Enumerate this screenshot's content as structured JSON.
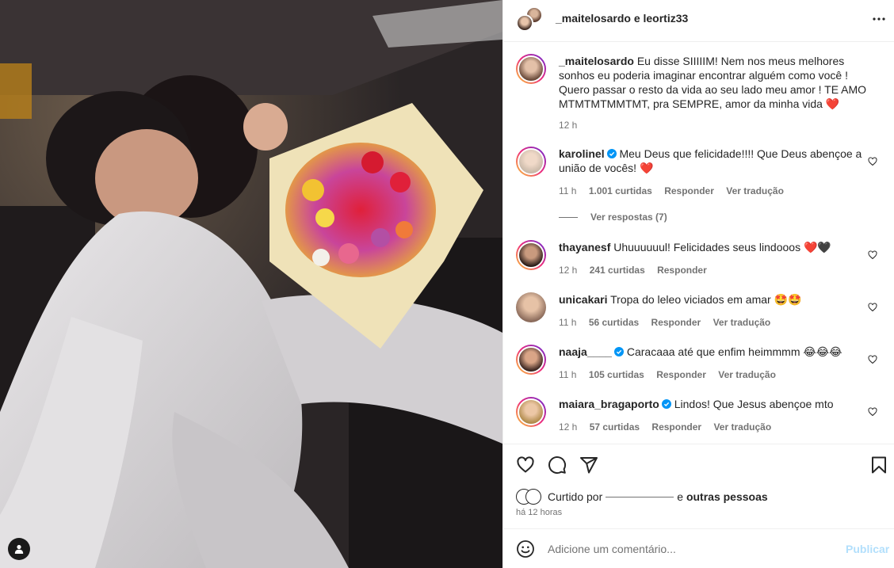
{
  "header": {
    "title": "_maitelosardo e leortiz33"
  },
  "caption": {
    "user": "_maitelosardo",
    "text": "Eu disse SIIIIIM! Nem nos meus melhores sonhos eu poderia imaginar encontrar alguém como você ! Quero passar o resto da vida ao seu lado meu amor ! TE AMO MTMTMTMMTMT, pra SEMPRE, amor da minha vida",
    "emoji": "❤️",
    "time": "12 h"
  },
  "comments": [
    {
      "user": "karolinel",
      "verified": true,
      "text": "Meu Deus que felicidade!!!! Que Deus abençoe a união de vocês!",
      "emoji": "❤️",
      "time": "11 h",
      "likes": "1.001 curtidas",
      "reply": "Responder",
      "translate": "Ver tradução"
    },
    {
      "user": "thayanesf",
      "verified": false,
      "text": "Uhuuuuuul! Felicidades seus lindooos",
      "emoji": "❤️🖤",
      "time": "12 h",
      "likes": "241 curtidas",
      "reply": "Responder",
      "translate": ""
    },
    {
      "user": "unicakari",
      "verified": false,
      "text": "Tropa do leleo viciados em amar",
      "emoji": "🤩🤩",
      "time": "11 h",
      "likes": "56 curtidas",
      "reply": "Responder",
      "translate": "Ver tradução"
    },
    {
      "user": "naaja____",
      "verified": true,
      "text": "Caracaaa até que enfim heimmmm",
      "emoji": "😂😂😂",
      "time": "11 h",
      "likes": "105 curtidas",
      "reply": "Responder",
      "translate": "Ver tradução"
    },
    {
      "user": "maiara_bragaporto",
      "verified": true,
      "text": "Lindos! Que Jesus abençoe mto",
      "emoji": "",
      "time": "12 h",
      "likes": "57 curtidas",
      "reply": "Responder",
      "translate": "Ver tradução"
    }
  ],
  "view_replies": "Ver respostas (7)",
  "liked_by": {
    "prefix": "Curtido por",
    "suffix_and": "e",
    "others": "outras pessoas"
  },
  "post_time": "há 12 horas",
  "add_comment": {
    "placeholder": "Adicione um comentário...",
    "publish": "Publicar"
  },
  "colors": {
    "heart_red": "#ed4956",
    "verified_blue": "#0095f6",
    "publish_disabled": "#b2dffc"
  },
  "icons": {
    "more": "more-options-icon",
    "like": "heart-icon",
    "comment": "comment-icon",
    "share": "paper-plane-icon",
    "save": "bookmark-icon",
    "emoji": "smiley-icon",
    "tag": "user-tag-icon"
  }
}
